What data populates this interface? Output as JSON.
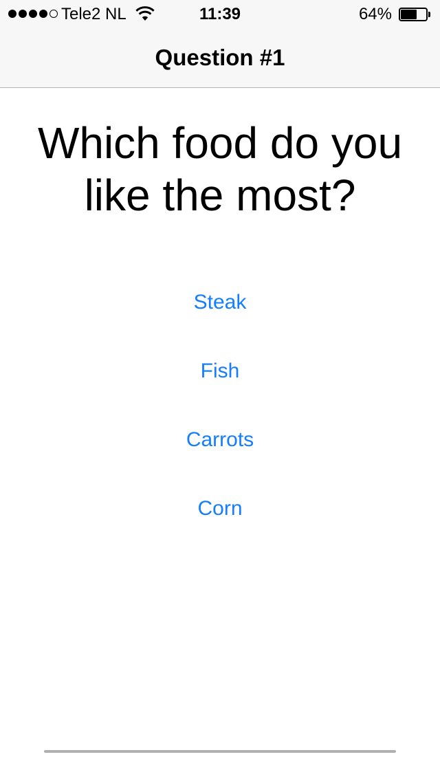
{
  "status_bar": {
    "signal_bars_filled": 4,
    "signal_bars_total": 5,
    "carrier": "Tele2 NL",
    "time": "11:39",
    "battery_percent_label": "64%",
    "battery_level": 0.64,
    "wifi_icon": "wifi-icon",
    "battery_icon": "battery-icon"
  },
  "nav": {
    "title": "Question #1"
  },
  "question": {
    "line1": "Which food do you",
    "line2": "like the most?"
  },
  "answers": [
    {
      "label": "Steak"
    },
    {
      "label": "Fish"
    },
    {
      "label": "Carrots"
    },
    {
      "label": "Corn"
    }
  ],
  "colors": {
    "accent": "#157efb",
    "nav_background": "#f7f7f7",
    "text": "#000000"
  }
}
